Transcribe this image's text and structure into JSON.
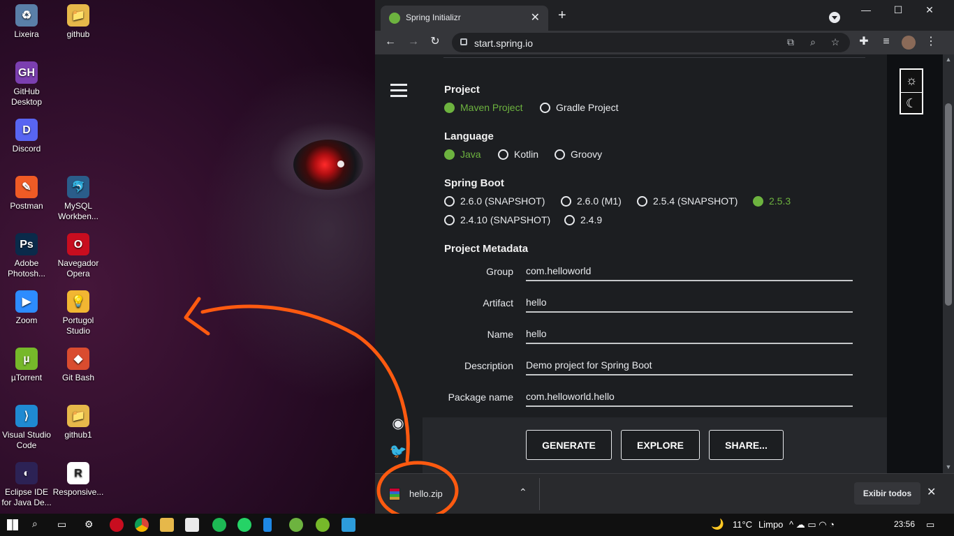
{
  "desktop": {
    "icons": [
      {
        "label": "Lixeira",
        "glyph": "♻",
        "color": "#5a7fa8"
      },
      {
        "label": "github",
        "glyph": "📁",
        "color": "#e6b84a"
      },
      {
        "label": "GitHub Desktop",
        "glyph": "GH",
        "color": "#7b3fb0"
      },
      {
        "label": "Discord",
        "glyph": "D",
        "color": "#5865f2"
      },
      {
        "label": "Postman",
        "glyph": "✎",
        "color": "#ef5b25"
      },
      {
        "label": "MySQL Workben...",
        "glyph": "🐬",
        "color": "#2a5d8a"
      },
      {
        "label": "Adobe Photosh...",
        "glyph": "Ps",
        "color": "#0a2a4a"
      },
      {
        "label": "Navegador Opera",
        "glyph": "O",
        "color": "#c80d1f"
      },
      {
        "label": "Zoom",
        "glyph": "▶",
        "color": "#2d8cff"
      },
      {
        "label": "Portugol Studio",
        "glyph": "💡",
        "color": "#f2b632"
      },
      {
        "label": "µTorrent",
        "glyph": "µ",
        "color": "#76b82a"
      },
      {
        "label": "Git Bash",
        "glyph": "◆",
        "color": "#d94c2f"
      },
      {
        "label": "Visual Studio Code",
        "glyph": "⟩",
        "color": "#1f8ad2"
      },
      {
        "label": "github1",
        "glyph": "📁",
        "color": "#e6b84a"
      },
      {
        "label": "Eclipse IDE for Java De...",
        "glyph": "◐",
        "color": "#2c2255"
      },
      {
        "label": "Responsive...",
        "glyph": "R",
        "color": "#ffffff"
      }
    ]
  },
  "browser": {
    "tab_title": "Spring Initializr",
    "tab_close": "✕",
    "new_tab": "+",
    "window_controls": {
      "minimize": "—",
      "maximize": "☐",
      "close": "✕"
    },
    "toolbar": {
      "back": "←",
      "forward": "→",
      "reload": "↻",
      "url": "start.spring.io",
      "menu": "⋮"
    },
    "omnibox_icons": {
      "translate": "⧉",
      "zoom": "⌕",
      "star": "☆"
    },
    "extension_icons": {
      "puzzle": "✚",
      "media": "≡"
    }
  },
  "page": {
    "project": {
      "title": "Project",
      "options": [
        {
          "label": "Maven Project",
          "selected": true
        },
        {
          "label": "Gradle Project",
          "selected": false
        }
      ]
    },
    "language": {
      "title": "Language",
      "options": [
        {
          "label": "Java",
          "selected": true
        },
        {
          "label": "Kotlin",
          "selected": false
        },
        {
          "label": "Groovy",
          "selected": false
        }
      ]
    },
    "spring_boot": {
      "title": "Spring Boot",
      "options": [
        {
          "label": "2.6.0 (SNAPSHOT)",
          "selected": false
        },
        {
          "label": "2.6.0 (M1)",
          "selected": false
        },
        {
          "label": "2.5.4 (SNAPSHOT)",
          "selected": false
        },
        {
          "label": "2.5.3",
          "selected": true
        },
        {
          "label": "2.4.10 (SNAPSHOT)",
          "selected": false
        },
        {
          "label": "2.4.9",
          "selected": false
        }
      ]
    },
    "metadata": {
      "title": "Project Metadata",
      "fields": [
        {
          "label": "Group",
          "value": "com.helloworld"
        },
        {
          "label": "Artifact",
          "value": "hello"
        },
        {
          "label": "Name",
          "value": "hello"
        },
        {
          "label": "Description",
          "value": "Demo project for Spring Boot"
        },
        {
          "label": "Package name",
          "value": "com.helloworld.hello"
        }
      ]
    },
    "actions": {
      "generate": "GENERATE",
      "explore": "EXPLORE",
      "share": "SHARE..."
    },
    "theme": {
      "light": "☼",
      "dark": "☾"
    },
    "social": {
      "github": "◉",
      "twitter": "🐦"
    }
  },
  "download_shelf": {
    "file_name": "hello.zip",
    "chevron": "⌃",
    "show_all": "Exibir todos",
    "close": "✕"
  },
  "taskbar": {
    "weather_icon": "🌙",
    "temperature": "11°C",
    "condition": "Limpo",
    "time": "23:56",
    "tray_icons": "^  ☁  ▭  ◠  ◔",
    "notifications": "▭"
  },
  "colors": {
    "spring_green": "#6db33f",
    "annotation_orange": "#ff5a10"
  }
}
